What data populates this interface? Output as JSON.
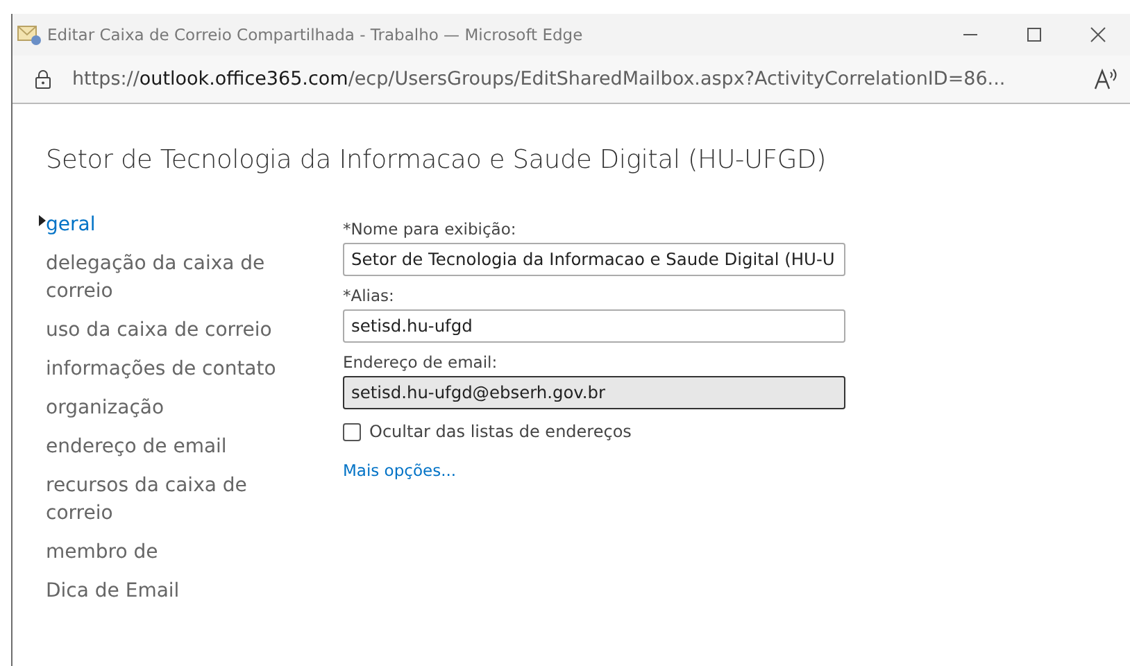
{
  "window": {
    "title": "Editar Caixa de Correio Compartilhada - Trabalho — Microsoft Edge",
    "controls": [
      {
        "kind": "minimize"
      },
      {
        "kind": "maximize"
      },
      {
        "kind": "close"
      }
    ]
  },
  "address_bar": {
    "scheme": "https://",
    "host": "outlook.office365.com",
    "path": "/ecp/UsersGroups/EditSharedMailbox.aspx?ActivityCorrelationID=86..."
  },
  "page_title": "Setor de Tecnologia da Informacao e Saude Digital (HU-UFGD)",
  "nav": [
    {
      "label": "geral",
      "selected": true
    },
    {
      "label": "delegação da caixa de correio",
      "selected": false
    },
    {
      "label": "uso da caixa de correio",
      "selected": false
    },
    {
      "label": "informações de contato",
      "selected": false
    },
    {
      "label": "organização",
      "selected": false
    },
    {
      "label": "endereço de email",
      "selected": false
    },
    {
      "label": "recursos da caixa de correio",
      "selected": false
    },
    {
      "label": "membro de",
      "selected": false
    },
    {
      "label": "Dica de Email",
      "selected": false
    }
  ],
  "fields": [
    {
      "label": "*Nome para exibição:",
      "value": "Setor de Tecnologia da Informacao e Saude Digital (HU-U",
      "disabled": false
    },
    {
      "label": "*Alias:",
      "value": "setisd.hu-ufgd",
      "disabled": false
    },
    {
      "label": "Endereço de email:",
      "value": "setisd.hu-ufgd@ebserh.gov.br",
      "disabled": true
    }
  ],
  "hide_checkbox": {
    "label": "Ocultar das listas de endereços",
    "checked": false
  },
  "more_link": "Mais opções..."
}
